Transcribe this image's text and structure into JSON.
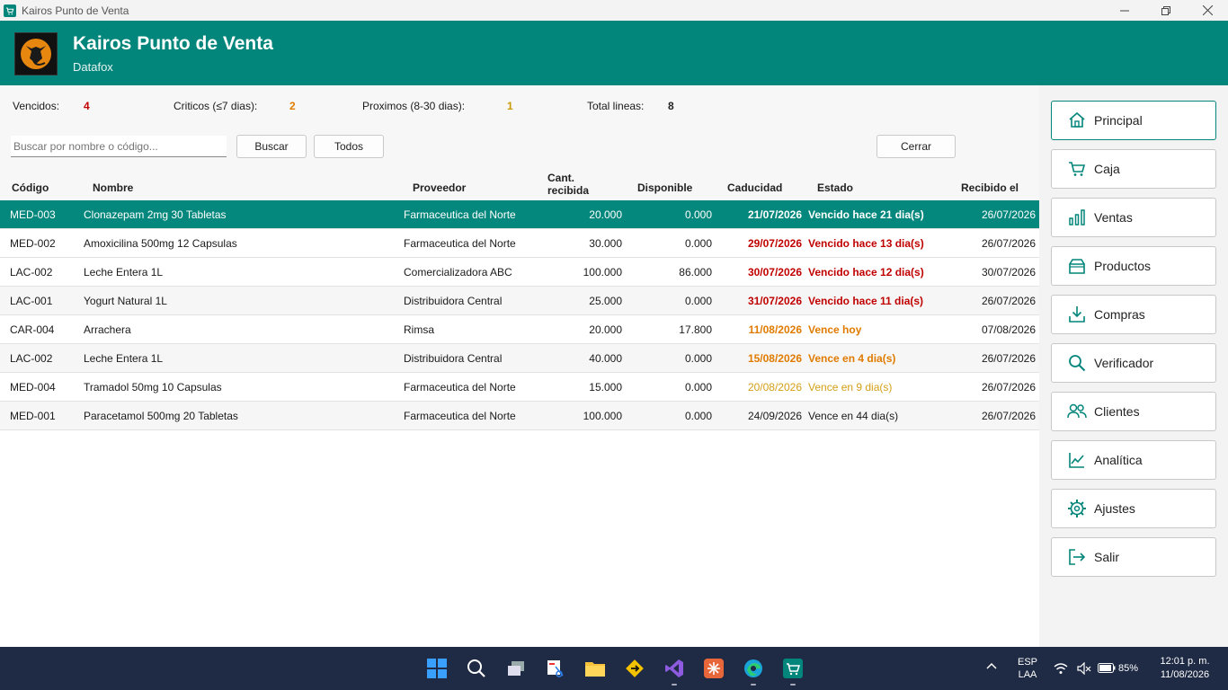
{
  "window": {
    "title": "Kairos Punto de Venta"
  },
  "header": {
    "title": "Kairos Punto de Venta",
    "subtitle": "Datafox"
  },
  "summary": {
    "vencidos_label": "Vencidos:",
    "vencidos_value": "4",
    "criticos_label": "Criticos (≤7 dias):",
    "criticos_value": "2",
    "proximos_label": "Proximos (8-30 dias):",
    "proximos_value": "1",
    "total_label": "Total lineas:",
    "total_value": "8"
  },
  "toolbar": {
    "search_placeholder": "Buscar por nombre o código...",
    "search_label": "Buscar",
    "all_label": "Todos",
    "close_label": "Cerrar"
  },
  "table": {
    "headers": {
      "codigo": "Código",
      "nombre": "Nombre",
      "proveedor": "Proveedor",
      "cant_1": "Cant.",
      "cant_2": "recibida",
      "disponible": "Disponible",
      "caducidad": "Caducidad",
      "estado": "Estado",
      "recibido": "Recibido el"
    },
    "rows": [
      {
        "codigo": "MED-003",
        "nombre": "Clonazepam 2mg 30 Tabletas",
        "proveedor": "Farmaceutica del Norte",
        "cant": "20.000",
        "disp": "0.000",
        "cad": "21/07/2026",
        "estado": "Vencido hace 21 dia(s)",
        "recibido": "26/07/2026"
      },
      {
        "codigo": "MED-002",
        "nombre": "Amoxicilina 500mg 12 Capsulas",
        "proveedor": "Farmaceutica del Norte",
        "cant": "30.000",
        "disp": "0.000",
        "cad": "29/07/2026",
        "estado": "Vencido hace 13 dia(s)",
        "recibido": "26/07/2026"
      },
      {
        "codigo": "LAC-002",
        "nombre": "Leche Entera 1L",
        "proveedor": "Comercializadora ABC",
        "cant": "100.000",
        "disp": "86.000",
        "cad": "30/07/2026",
        "estado": "Vencido hace 12 dia(s)",
        "recibido": "30/07/2026"
      },
      {
        "codigo": "LAC-001",
        "nombre": "Yogurt Natural 1L",
        "proveedor": "Distribuidora Central",
        "cant": "25.000",
        "disp": "0.000",
        "cad": "31/07/2026",
        "estado": "Vencido hace 11 dia(s)",
        "recibido": "26/07/2026"
      },
      {
        "codigo": "CAR-004",
        "nombre": "Arrachera",
        "proveedor": "Rimsa",
        "cant": "20.000",
        "disp": "17.800",
        "cad": "11/08/2026",
        "estado": "Vence hoy",
        "recibido": "07/08/2026"
      },
      {
        "codigo": "LAC-002",
        "nombre": "Leche Entera 1L",
        "proveedor": "Distribuidora Central",
        "cant": "40.000",
        "disp": "0.000",
        "cad": "15/08/2026",
        "estado": "Vence en 4 dia(s)",
        "recibido": "26/07/2026"
      },
      {
        "codigo": "MED-004",
        "nombre": "Tramadol 50mg 10 Capsulas",
        "proveedor": "Farmaceutica del Norte",
        "cant": "15.000",
        "disp": "0.000",
        "cad": "20/08/2026",
        "estado": "Vence en 9 dia(s)",
        "recibido": "26/07/2026"
      },
      {
        "codigo": "MED-001",
        "nombre": "Paracetamol 500mg 20 Tabletas",
        "proveedor": "Farmaceutica del Norte",
        "cant": "100.000",
        "disp": "0.000",
        "cad": "24/09/2026",
        "estado": "Vence en 44 dia(s)",
        "recibido": "26/07/2026"
      }
    ]
  },
  "sidebar": {
    "items": [
      {
        "label": "Principal",
        "icon": "home-icon"
      },
      {
        "label": "Caja",
        "icon": "cart-icon"
      },
      {
        "label": "Ventas",
        "icon": "bar-chart-icon"
      },
      {
        "label": "Productos",
        "icon": "box-icon"
      },
      {
        "label": "Compras",
        "icon": "download-icon"
      },
      {
        "label": "Verificador",
        "icon": "search-icon"
      },
      {
        "label": "Clientes",
        "icon": "users-icon"
      },
      {
        "label": "Analítica",
        "icon": "line-chart-icon"
      },
      {
        "label": "Ajustes",
        "icon": "gear-icon"
      },
      {
        "label": "Salir",
        "icon": "logout-icon"
      }
    ]
  },
  "taskbar": {
    "lang_1": "ESP",
    "lang_2": "LAA",
    "battery": "85%",
    "time": "12:01 p. m.",
    "date": "11/08/2026"
  },
  "colors": {
    "brand": "#02857a",
    "expired": "#c00000",
    "warning": "#e07b00",
    "taskbar": "#1f2a44"
  }
}
